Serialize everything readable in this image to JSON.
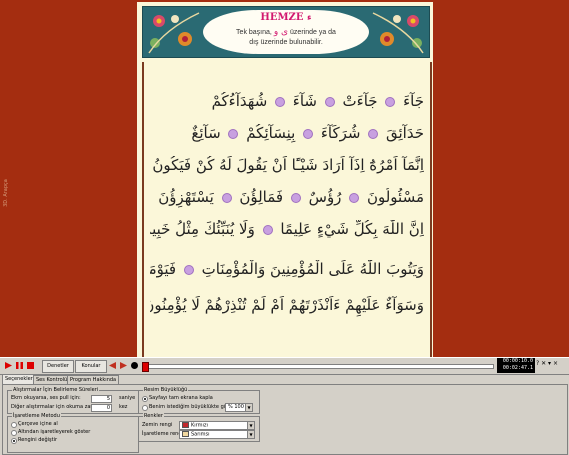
{
  "side_label": "3D. Arapça",
  "header": {
    "title": "HEMZE",
    "title_letter": "ء",
    "line1_a": "Tek başına,",
    "line1_letters": "ى و",
    "line1_b": "üzerinde ya da",
    "line2": "dış üzerinde bulunabilir."
  },
  "arabic_lines": [
    "جَآءَ ● جَآءَتْ ● شَآءَ ● شُهَدَآءُكُمْ",
    "حَدَآئِقَ ● شُرَكَآءَ ● بِنِسَآئِكُمْ ● سَآئِغٌ",
    "اِنَّمَآ اَمْرُهُٓ اِذَآ اَرَادَ شَيْـًٔا اَنْ يَقُولَ لَهُ كُنْ فَيَكُونُ ●",
    "مَسْئُولُونَ ● رُؤُسٌ ● فَمَالِؤُنَ ● يَسْتَهْزِؤُنَ ●",
    "اِنَّ اللّٰهَ بِكُلِّ شَيْءٍ عَلِيمًا ● وَلَا يُنَبِّئُكَ مِثْلُ خَبِيرٍ",
    "وَيَتُوبَ اللّٰهُ عَلَى الْمُؤْمِنِينَ وَالْمُؤْمِنَاتِ ● فَيَوْمَئِذٍ ●",
    "وَسَوَآءٌ عَلَيْهِمْ ءَاَنْذَرْتَهُمْ اَمْ لَمْ تُنْذِرْهُمْ لَا يُؤْمِنُونَ ●"
  ],
  "toolbar": {
    "btn_denetler": "Denetler",
    "btn_konular": "Konular",
    "time_current": "00:00:10.0",
    "time_total": "00:02:47.1",
    "progress": 0.0,
    "right_icons": "? ✕ ▾ ×"
  },
  "tabs": [
    "Seçenekler",
    "Ses Kontrolü",
    "Program Hakkında"
  ],
  "options": {
    "repeat_group": "Alıştırmalar İçin Belirleme Süreleri",
    "row1_label": "Ekrn okuyarsa, ses pull için:",
    "row1_value": "5",
    "row1_unit": "saniye",
    "row2_label": "Diğer alıştırmalar için okuma zamanı:",
    "row2_value": "0",
    "row2_unit": "kez",
    "method_group": "İşaretleme Metodu",
    "method_options": [
      "Çerçeve içine al",
      "Altından işaretleyerek göster",
      "Rengini değiştir"
    ],
    "method_selected": 2,
    "view_group": "Resim Büyüklüğü",
    "view_options": [
      "Sayfayı tam ekrana kapla",
      "Benim istediğim büyüklükte göster:"
    ],
    "view_selected": 0,
    "zoom_value": "% 100",
    "colors_group": "Renkler",
    "bg_label": "Zemin rengi",
    "bg_value": "Kırmızı",
    "bg_color": "#c0282d",
    "mark_label": "İşaretleme rengi",
    "mark_value": "Sarımsı",
    "mark_color": "#f0d8a0"
  },
  "colors": {
    "background": "#a42d10",
    "page": "#fbf7d9",
    "accent": "#d2186f"
  }
}
